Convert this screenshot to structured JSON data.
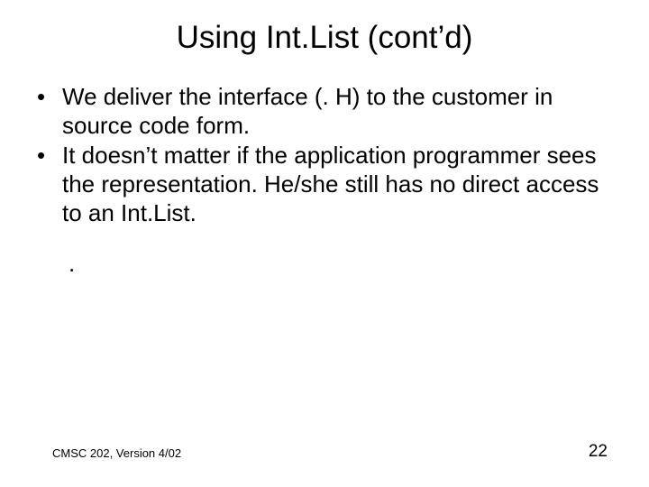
{
  "title": "Using Int.List (cont’d)",
  "bullets": [
    "We deliver the interface (. H) to the customer in source code form.",
    "It doesn’t matter if the application programmer sees the representation. He/she still has no direct access to an Int.List."
  ],
  "lone_dot": ".",
  "footer_left": "CMSC 202, Version 4/02",
  "footer_right": "22"
}
